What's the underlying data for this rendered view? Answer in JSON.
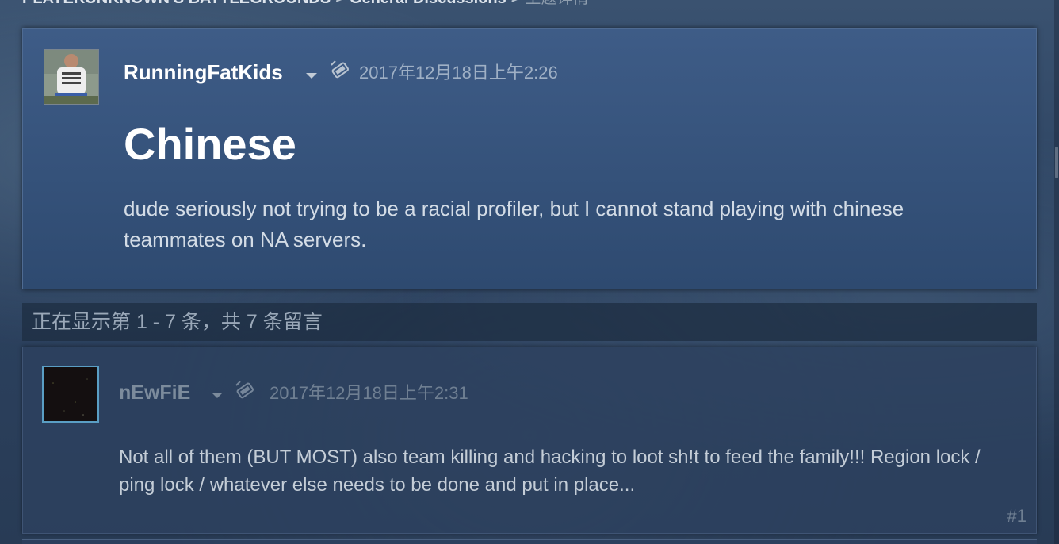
{
  "breadcrumb": {
    "game": "PLAYERUNKNOWN'S BATTLEGROUNDS",
    "separator": ">",
    "forum": "General Discussions",
    "separator2": ">",
    "current": "主题详情"
  },
  "op": {
    "author": "RunningFatKids",
    "timestamp": "2017年12月18日上午2:26",
    "title": "Chinese",
    "body": "dude seriously not trying to be a racial profiler, but I cannot stand playing with chinese teammates on NA servers.",
    "avatar_icon": "avatar-image",
    "platform_icon": "pc-icon"
  },
  "comments_header": {
    "text": "正在显示第 1 - 7 条，共 7 条留言"
  },
  "replies": [
    {
      "author": "nEwFiE",
      "timestamp": "2017年12月18日上午2:31",
      "body": "Not all of them (BUT MOST) also team killing and hacking to loot sh!t to feed the family!!! Region lock / ping lock / whatever else needs to be done and put in place...",
      "number": "#1",
      "avatar_icon": "avatar-image",
      "platform_icon": "pc-icon"
    }
  ],
  "colors": {
    "op_panel": "#3e5c87",
    "reply_panel": "#2d415f",
    "accent_border": "#5a9ec4",
    "text_primary": "#ffffff",
    "text_muted": "#9fb0c5"
  }
}
